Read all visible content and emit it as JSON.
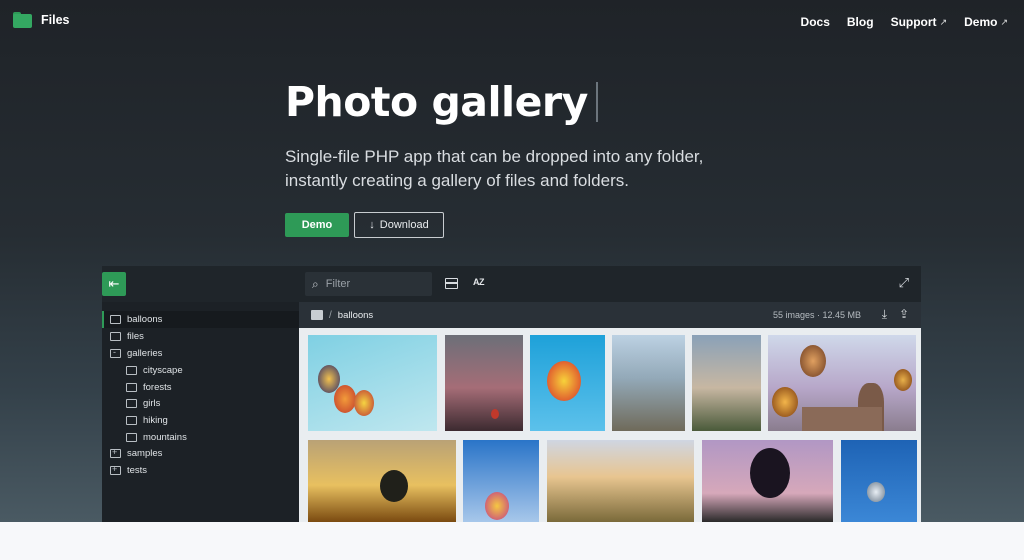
{
  "nav": {
    "brand": "Files",
    "links": [
      {
        "label": "Docs",
        "external": false
      },
      {
        "label": "Blog",
        "external": false
      },
      {
        "label": "Support",
        "external": true
      },
      {
        "label": "Demo",
        "external": true
      }
    ],
    "external_glyph": "↗"
  },
  "hero": {
    "title": "Photo gallery",
    "subtitle": "Single-file PHP app that can be dropped into any folder, instantly creating a gallery of files and folders.",
    "demo_button": "Demo",
    "download_button": "Download",
    "download_glyph": "↓"
  },
  "app": {
    "filter_placeholder": "Filter",
    "sort_label": "AZ",
    "breadcrumb": "balloons",
    "stats": "55 images · 12.45 MB",
    "tree": [
      {
        "label": "balloons",
        "active": true,
        "icon": "folder-icon"
      },
      {
        "label": "files",
        "icon": "folder-icon"
      },
      {
        "label": "galleries",
        "icon": "folder-open-icon"
      },
      {
        "label": "cityscape",
        "icon": "folder-icon"
      },
      {
        "label": "forests",
        "icon": "folder-icon"
      },
      {
        "label": "girls",
        "icon": "folder-icon"
      },
      {
        "label": "hiking",
        "icon": "folder-icon"
      },
      {
        "label": "mountains",
        "icon": "folder-icon"
      },
      {
        "label": "samples",
        "icon": "folder-plus-icon"
      },
      {
        "label": "tests",
        "icon": "folder-plus-icon"
      }
    ]
  },
  "colors": {
    "accent": "#2e9a57",
    "hero_bg_top": "#1f2328",
    "hero_bg_bottom": "#4a5a63",
    "footer_bg": "#f7f8fa"
  }
}
